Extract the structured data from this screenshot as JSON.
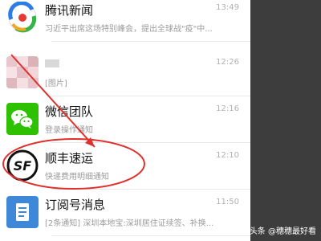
{
  "chats": [
    {
      "name": "腾讯新闻",
      "preview": "习近平出席这场特别峰会，提出全球战\"疫\"中...",
      "time": "13:49",
      "icon": "tencent-news-icon"
    },
    {
      "name": "",
      "preview": "[图片]",
      "time": "12:26",
      "icon": "blurred-avatar"
    },
    {
      "name": "微信团队",
      "preview": "登录操作通知",
      "time": "12:16",
      "icon": "wechat-icon"
    },
    {
      "name": "顺丰速运",
      "preview": "快递费用明细通知",
      "time": "12:10",
      "icon": "sf-express-icon"
    },
    {
      "name": "订阅号消息",
      "preview": "[2条通知] 深圳本地宝:深圳居住证续签、补换...",
      "time": "11:50",
      "icon": "subscription-icon"
    }
  ],
  "watermark": "头条 @穗穗最好看",
  "colors": {
    "annotation": "#e0302c",
    "wechat_green": "#2dc100",
    "subscription_blue": "#3f87d9"
  }
}
